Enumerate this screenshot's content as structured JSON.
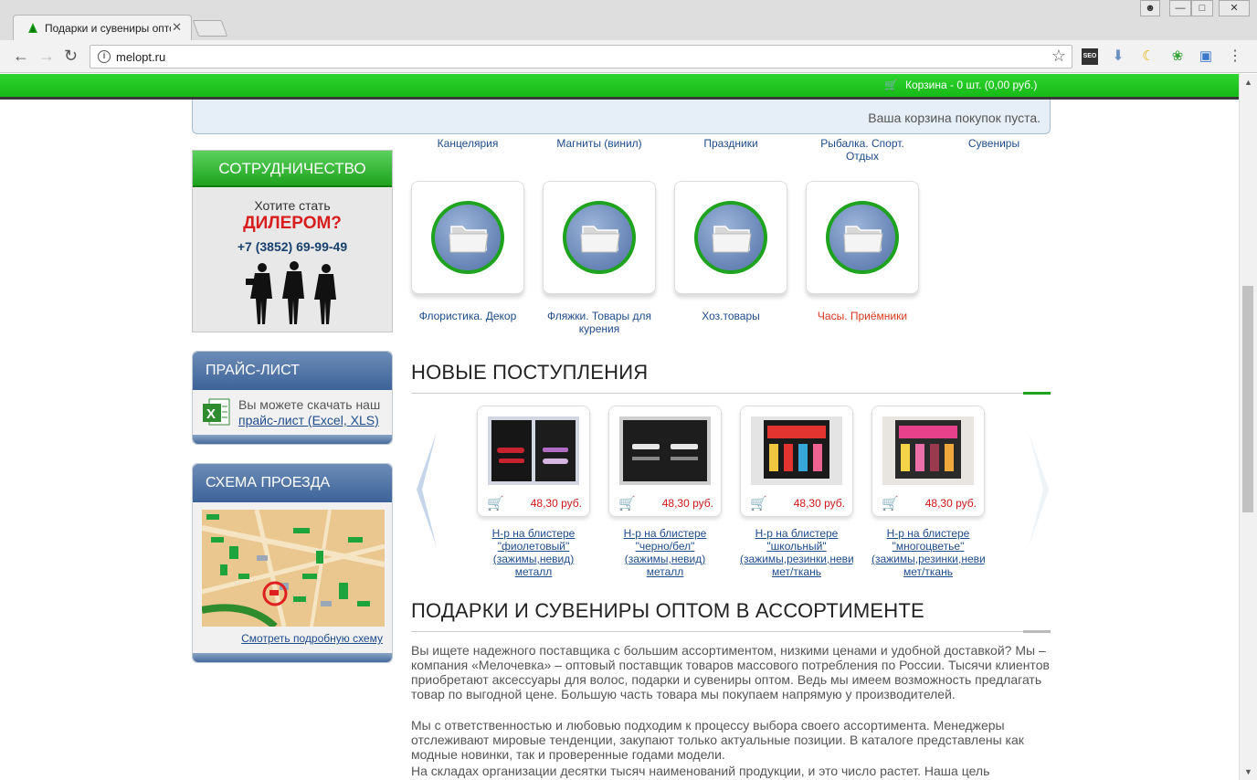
{
  "browser": {
    "tab_title": "Подарки и сувениры оптом",
    "url": "melopt.ru"
  },
  "header": {
    "cart_text": "Корзина - 0 шт. (0,00 руб.)",
    "cart_empty": "Ваша корзина покупок пуста."
  },
  "sidebar": {
    "coop_title": "СОТРУДНИЧЕСТВО",
    "coop_question": "Хотите стать",
    "coop_dealer": "ДИЛЕРОМ?",
    "coop_phone": "+7 (3852) 69-99-49",
    "price_title": "ПРАЙС-ЛИСТ",
    "price_text": "Вы можете скачать наш",
    "price_link": "прайс-лист (Excel, XLS)",
    "map_title": "СХЕМА ПРОЕЗДА",
    "map_link": "Смотреть подробную схему"
  },
  "categories_top": [
    "Канцелярия",
    "Магниты (винил)",
    "Праздники",
    "Рыбалка. Спорт. Отдых",
    "Сувениры"
  ],
  "categories": [
    {
      "name": "Флористика. Декор",
      "highlight": false
    },
    {
      "name": "Фляжки. Товары для курения",
      "highlight": false
    },
    {
      "name": "Хоз.товары",
      "highlight": false
    },
    {
      "name": "Часы. Приёмники",
      "highlight": true
    }
  ],
  "new_arrivals": {
    "title": "НОВЫЕ ПОСТУПЛЕНИЯ",
    "products": [
      {
        "price": "48,30 руб.",
        "name": "Н-р на блистере \"фиолетовый\" (зажимы,невид) металл"
      },
      {
        "price": "48,30 руб.",
        "name": "Н-р на блистере \"черно/бел\" (зажимы,невид) металл"
      },
      {
        "price": "48,30 руб.",
        "name": "Н-р на блистере \"школьный\" (зажимы,резинки,невид) мет/ткань"
      },
      {
        "price": "48,30 руб.",
        "name": "Н-р на блистере \"многоцветье\" (зажимы,резинки,невид) мет/ткань"
      }
    ]
  },
  "about": {
    "title": "ПОДАРКИ И СУВЕНИРЫ ОПТОМ В АССОРТИМЕНТЕ",
    "p1": "Вы ищете надежного поставщика с большим ассортиментом, низкими ценами и удобной доставкой? Мы – компания «Мелочевка» – оптовый поставщик товаров массового потребления по России. Тысячи клиентов приобретают аксессуары для волос, подарки и сувениры оптом. Ведь мы имеем возможность предлагать товар по выгодной цене. Большую часть товара мы покупаем напрямую у производителей.",
    "p2": "Мы с ответственностью и любовью подходим к процессу выбора своего ассортимента. Менеджеры отслеживают мировые тенденции, закупают только актуальные позиции. В каталоге представлены как модные новинки, так и проверенные годами модели.",
    "p3": "На складах организации десятки тысяч наименований продукции, и это число растет. Наша цель"
  },
  "colors": {
    "green": "#1ea31e",
    "link": "#1d4b8c",
    "price": "#d01818",
    "panel": "#3c6398"
  }
}
